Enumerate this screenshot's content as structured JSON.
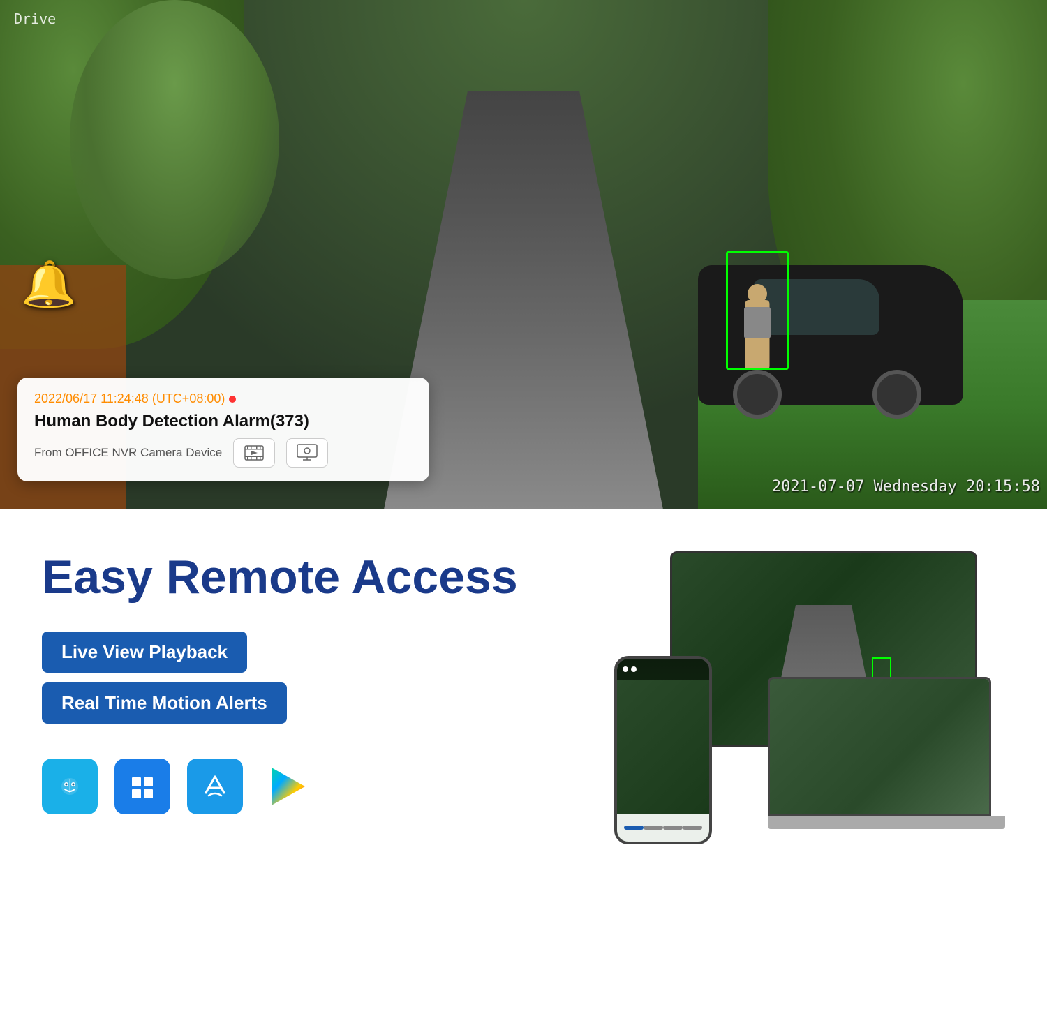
{
  "camera": {
    "drive_label": "Drive",
    "timestamp": "2021-07-07 Wednesday 20:15:58",
    "bell_icon": "🔔"
  },
  "notification": {
    "time": "2022/06/17 11:24:48 (UTC+08:00)",
    "title": "Human Body Detection Alarm(373)",
    "source": "From OFFICE NVR Camera Device",
    "playback_icon": "▶",
    "monitor_icon": "🖥"
  },
  "easy_access": {
    "title": "Easy Remote Access",
    "pills": [
      "Live View  Playback",
      "Real Time Motion Alerts"
    ]
  },
  "platforms": [
    {
      "name": "Finder / Mac",
      "icon": "mac"
    },
    {
      "name": "Windows",
      "icon": "windows"
    },
    {
      "name": "App Store",
      "icon": "appstore"
    },
    {
      "name": "Google Play",
      "icon": "googleplay"
    }
  ]
}
